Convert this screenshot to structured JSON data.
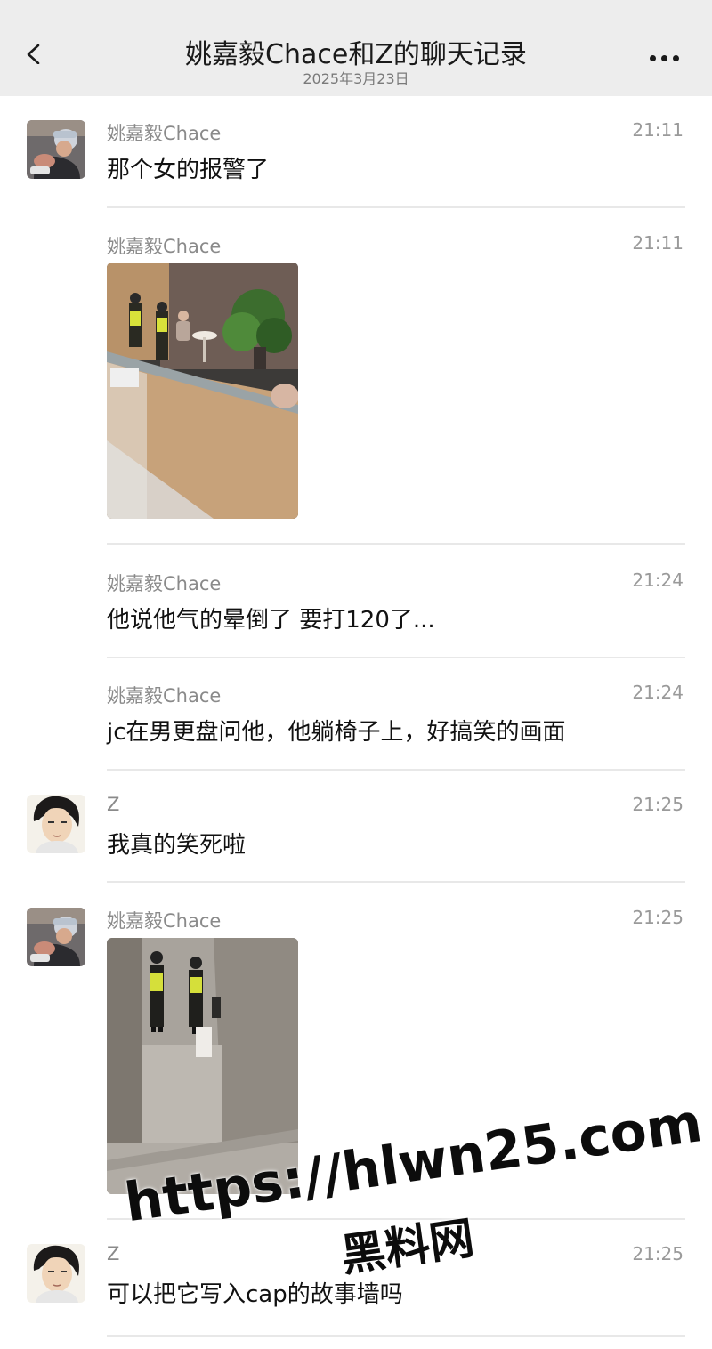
{
  "header": {
    "title": "姚嘉毅Chace和Z的聊天记录",
    "date": "2025年3月23日"
  },
  "messages": [
    {
      "sender": "姚嘉毅Chace",
      "time": "21:11",
      "text": "那个女的报警了"
    },
    {
      "sender": "姚嘉毅Chace",
      "time": "21:11",
      "image": "photo-police-lobby"
    },
    {
      "sender": "姚嘉毅Chace",
      "time": "21:24",
      "text": "他说他气的晕倒了 要打120了..."
    },
    {
      "sender": "姚嘉毅Chace",
      "time": "21:24",
      "text": "jc在男更盘问他，他躺椅子上，好搞笑的画面"
    },
    {
      "sender": "Z",
      "time": "21:25",
      "text": "我真的笑死啦"
    },
    {
      "sender": "姚嘉毅Chace",
      "time": "21:25",
      "image": "photo-police-corridor"
    },
    {
      "sender": "Z",
      "time": "21:25",
      "text": "可以把它写入cap的故事墙吗"
    }
  ],
  "watermark": {
    "url": "https://hlwn25.com",
    "label": "黑料网"
  },
  "colors": {
    "nav_bg": "#ededed",
    "name_gray": "#8a8a8a",
    "separator": "#e8e8e8"
  }
}
